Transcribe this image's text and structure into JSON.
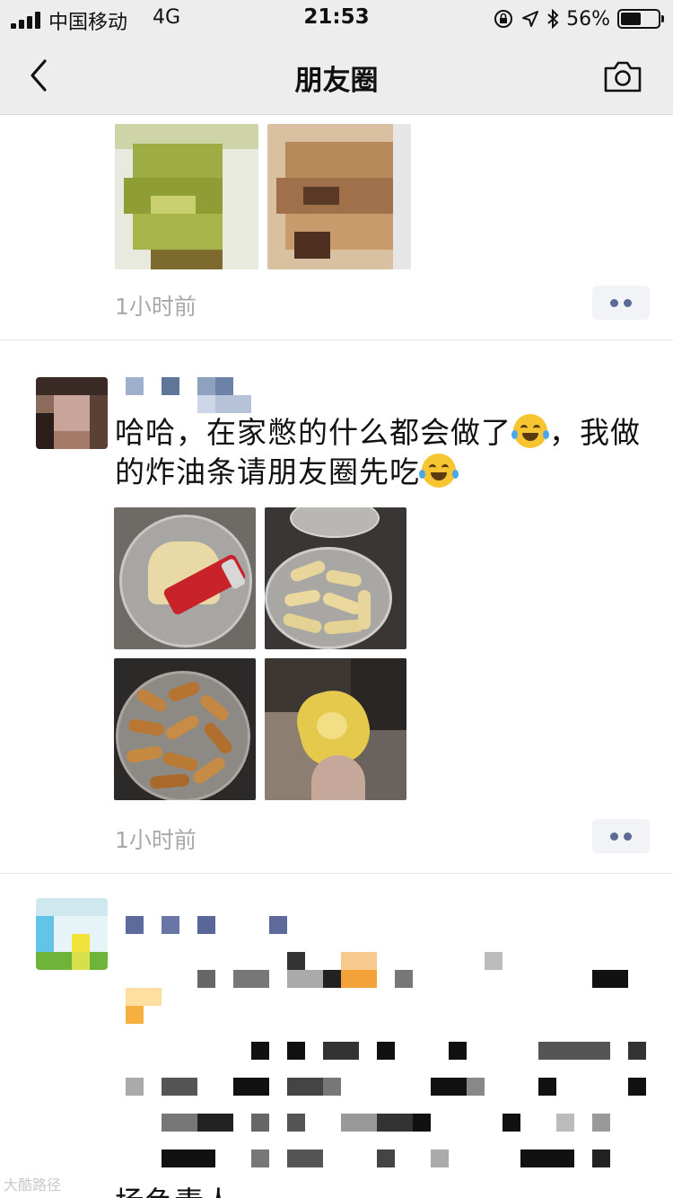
{
  "status_bar": {
    "carrier": "中国移动",
    "network": "4G",
    "time": "21:53",
    "battery_percent_text": "56%",
    "battery_level": 0.56
  },
  "nav": {
    "title": "朋友圈",
    "back_icon": "chevron-left-icon",
    "camera_icon": "camera-icon"
  },
  "posts": [
    {
      "timestamp": "1小时前"
    },
    {
      "text_line1": "哈哈，在家憋的什么都会做了",
      "text_line1_end": "，我做",
      "text_line2": "的炸油条请朋友圈先吃",
      "emoji1": "crying-laughing-emoji",
      "emoji2": "tears-of-joy-emoji",
      "timestamp": "1小时前"
    },
    {
      "partial_text": "场负责人"
    }
  ],
  "watermark": "大酷路径",
  "colors": {
    "nav_bg": "#ededed",
    "timestamp": "#a9a9a9",
    "more_dots": "#5c6b94"
  }
}
